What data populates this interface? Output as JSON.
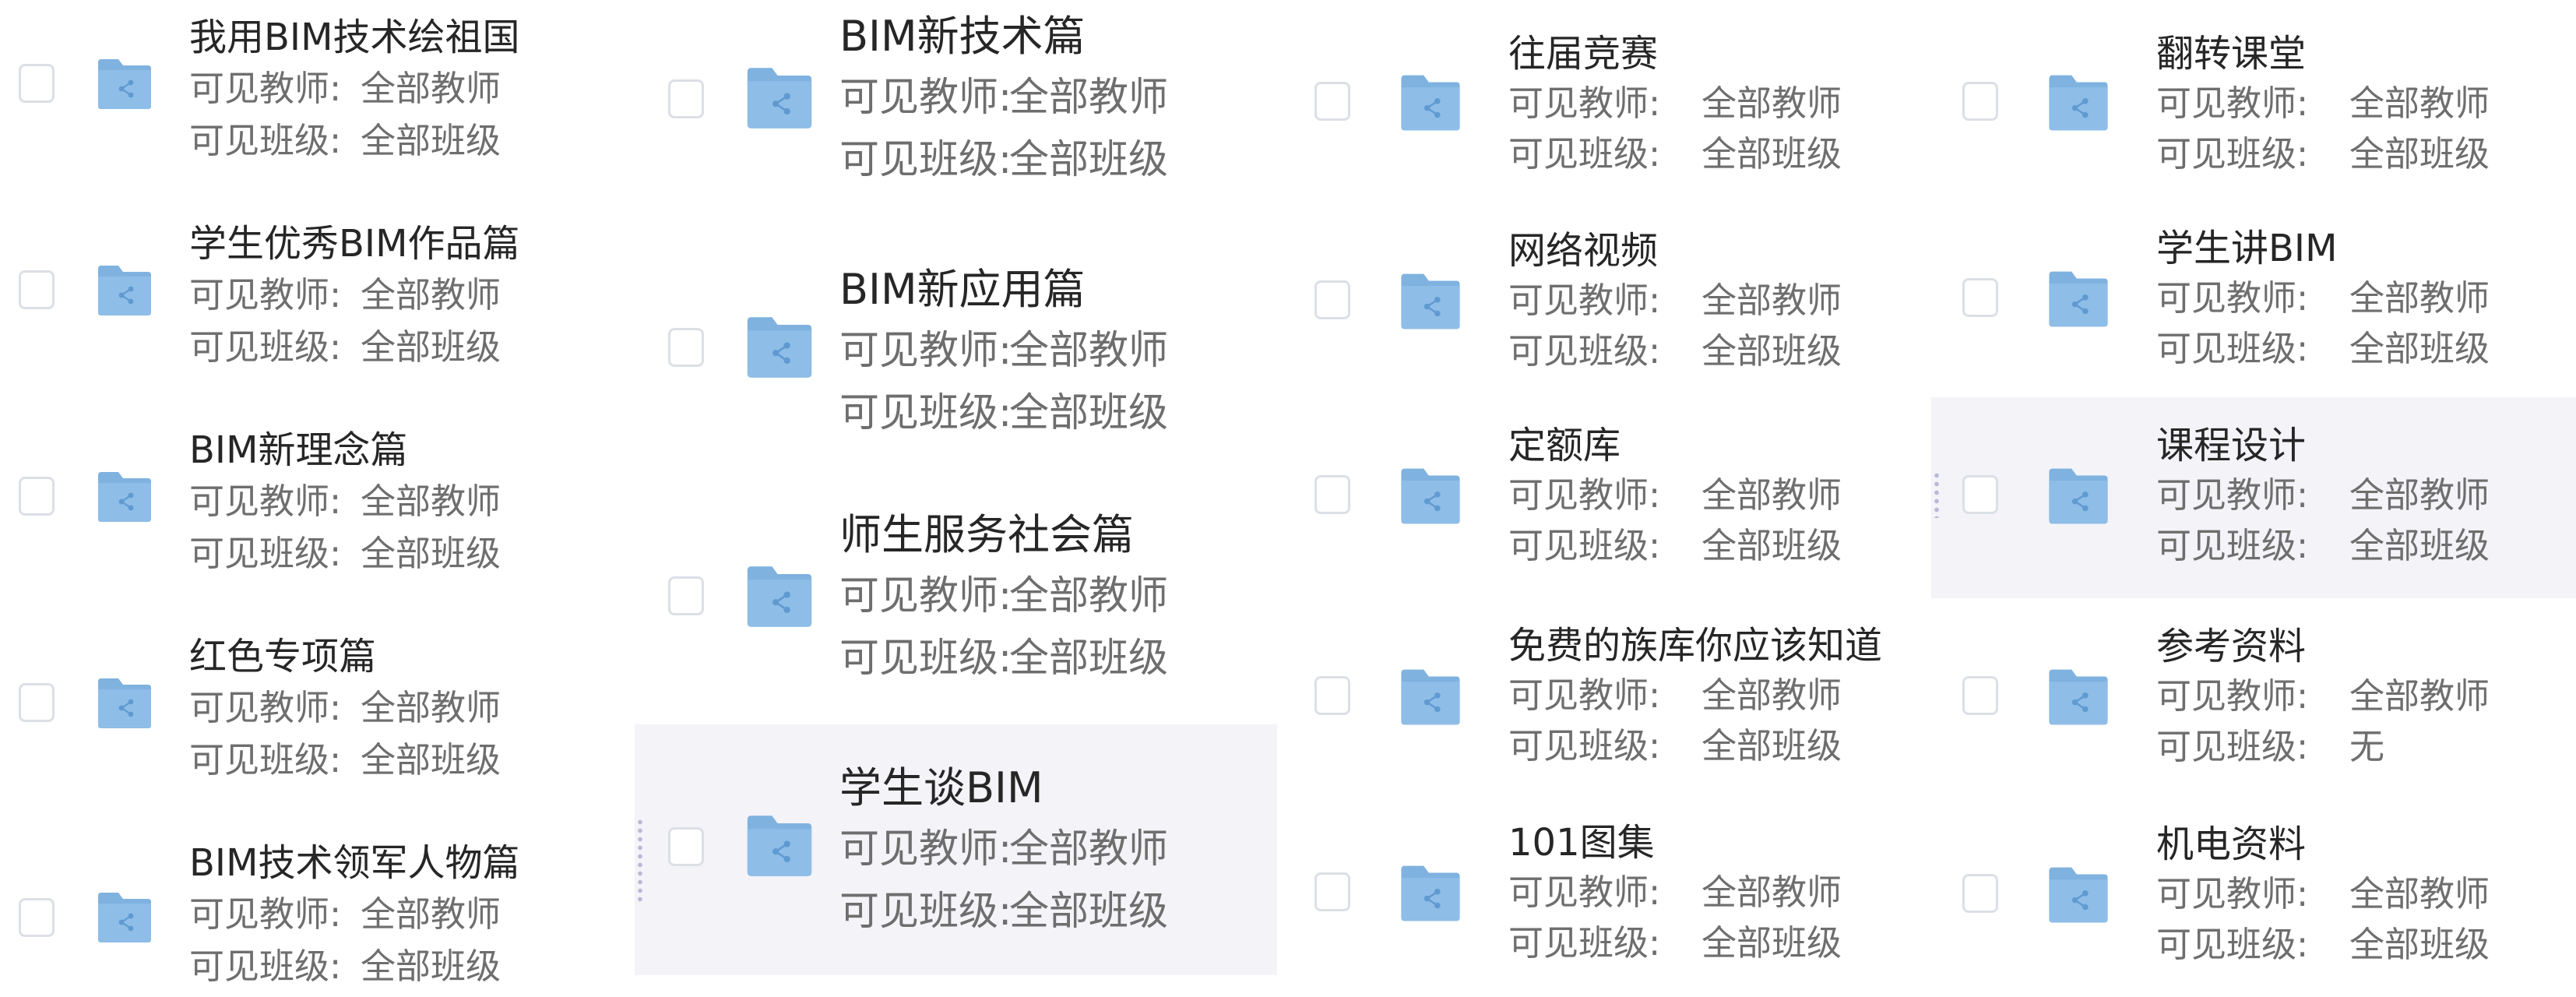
{
  "meta_labels": {
    "teacher": "可见教师:",
    "class": "可见班级:"
  },
  "folders": [
    {
      "name": "我用BIM技术绘祖国",
      "teachers": "全部教师",
      "classes": "全部班级",
      "icon": "shared-folder-icon"
    },
    {
      "name": "学生优秀BIM作品篇",
      "teachers": "全部教师",
      "classes": "全部班级",
      "icon": "shared-folder-icon"
    },
    {
      "name": "BIM新理念篇",
      "teachers": "全部教师",
      "classes": "全部班级",
      "icon": "shared-folder-icon"
    },
    {
      "name": "红色专项篇",
      "teachers": "全部教师",
      "classes": "全部班级",
      "icon": "shared-folder-icon"
    },
    {
      "name": "BIM技术领军人物篇",
      "teachers": "全部教师",
      "classes": "全部班级",
      "icon": "shared-folder-icon"
    },
    {
      "name": "BIM新技术篇",
      "teachers": "全部教师",
      "classes": "全部班级",
      "icon": "shared-folder-icon"
    },
    {
      "name": "BIM新应用篇",
      "teachers": "全部教师",
      "classes": "全部班级",
      "icon": "shared-folder-icon"
    },
    {
      "name": "师生服务社会篇",
      "teachers": "全部教师",
      "classes": "全部班级",
      "icon": "shared-folder-icon"
    },
    {
      "name": "学生谈BIM",
      "teachers": "全部教师",
      "classes": "全部班级",
      "icon": "shared-folder-icon",
      "hovered": true
    },
    {
      "name": "往届竞赛",
      "teachers": "全部教师",
      "classes": "全部班级",
      "icon": "shared-folder-icon"
    },
    {
      "name": "网络视频",
      "teachers": "全部教师",
      "classes": "全部班级",
      "icon": "shared-folder-icon"
    },
    {
      "name": "定额库",
      "teachers": "全部教师",
      "classes": "全部班级",
      "icon": "shared-folder-icon"
    },
    {
      "name": "免费的族库你应该知道",
      "teachers": "全部教师",
      "classes": "全部班级",
      "icon": "shared-folder-icon"
    },
    {
      "name": "101图集",
      "teachers": "全部教师",
      "classes": "全部班级",
      "icon": "shared-folder-icon"
    },
    {
      "name": "翻转课堂",
      "teachers": "全部教师",
      "classes": "全部班级",
      "icon": "shared-folder-icon"
    },
    {
      "name": "学生讲BIM",
      "teachers": "全部教师",
      "classes": "全部班级",
      "icon": "shared-folder-icon"
    },
    {
      "name": "课程设计",
      "teachers": "全部教师",
      "classes": "全部班级",
      "icon": "shared-folder-icon",
      "hovered": true
    },
    {
      "name": "参考资料",
      "teachers": "全部教师",
      "classes": "无",
      "icon": "shared-folder-icon"
    },
    {
      "name": "机电资料",
      "teachers": "全部教师",
      "classes": "全部班级",
      "icon": "shared-folder-icon"
    }
  ],
  "colors": {
    "folder": "#8ebde7",
    "folder_tab": "#7fb2df",
    "share_glyph": "#5f9ad1",
    "hover_bg": "#f3f3f8",
    "title_text": "#262626",
    "meta_text": "#6e6e6e",
    "checkbox_border": "#dcdfe6"
  }
}
